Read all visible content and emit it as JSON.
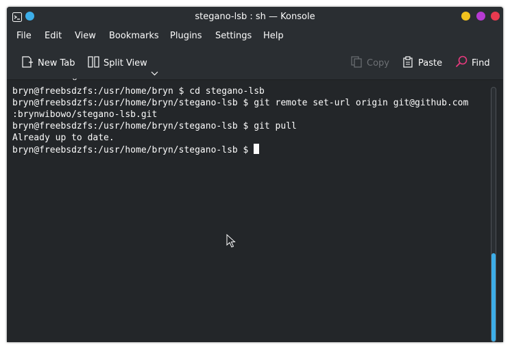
{
  "window": {
    "title": "stegano-lsb : sh — Konsole"
  },
  "menu": [
    "File",
    "Edit",
    "View",
    "Bookmarks",
    "Plugins",
    "Settings",
    "Help"
  ],
  "toolbar": {
    "new_tab": "New Tab",
    "split_view": "Split View",
    "copy": "Copy",
    "paste": "Paste",
    "find": "Find"
  },
  "terminal": {
    "lines": [
      "bryn@freebsdzfs:/usr/home/bryn $ cd stegano-lsb",
      "bryn@freebsdzfs:/usr/home/bryn/stegano-lsb $ git remote set-url origin git@github.com",
      ":brynwibowo/stegano-lsb.git",
      "bryn@freebsdzfs:/usr/home/bryn/stegano-lsb $ git pull",
      "Already up to date.",
      "bryn@freebsdzfs:/usr/home/bryn/stegano-lsb $ "
    ]
  },
  "colors": {
    "accent": "#3daee9",
    "background": "#232629",
    "foreground": "#fcfcfc",
    "minimize": "#f2c21e",
    "maximize": "#b63ad3",
    "close": "#e93a4f"
  },
  "icons": {
    "app": "terminal-icon",
    "pin": "keep-above-icon",
    "new_tab": "new-tab-icon",
    "split_view": "split-view-icon",
    "copy": "copy-icon",
    "paste": "paste-icon",
    "find": "find-icon"
  }
}
